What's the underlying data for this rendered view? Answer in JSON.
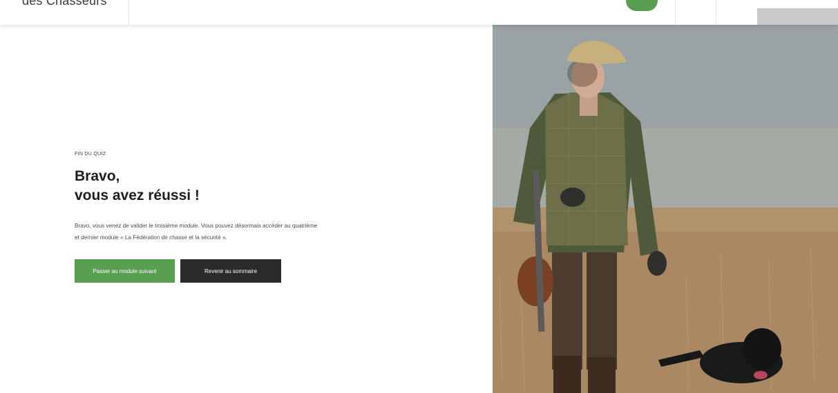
{
  "header": {
    "logo_text": "des Chasseurs"
  },
  "quiz": {
    "eyebrow": "FIN DU QUIZ",
    "title_highlight": "Bravo,",
    "title_rest": "vous avez réussi !",
    "body_line1": "Bravo, vous venez de valider le troisième module. Vous pouvez désormais accéder au quatrième",
    "body_line2": "et dernier module « La Fédération de chasse et la sécurité ».",
    "next_button": "Passer au module suivant",
    "back_button": "Revenir au sommaire"
  },
  "colors": {
    "accent_green": "#5a9e52",
    "highlight_yellow": "#c4de3a",
    "dark_button": "#2b2b2b"
  }
}
